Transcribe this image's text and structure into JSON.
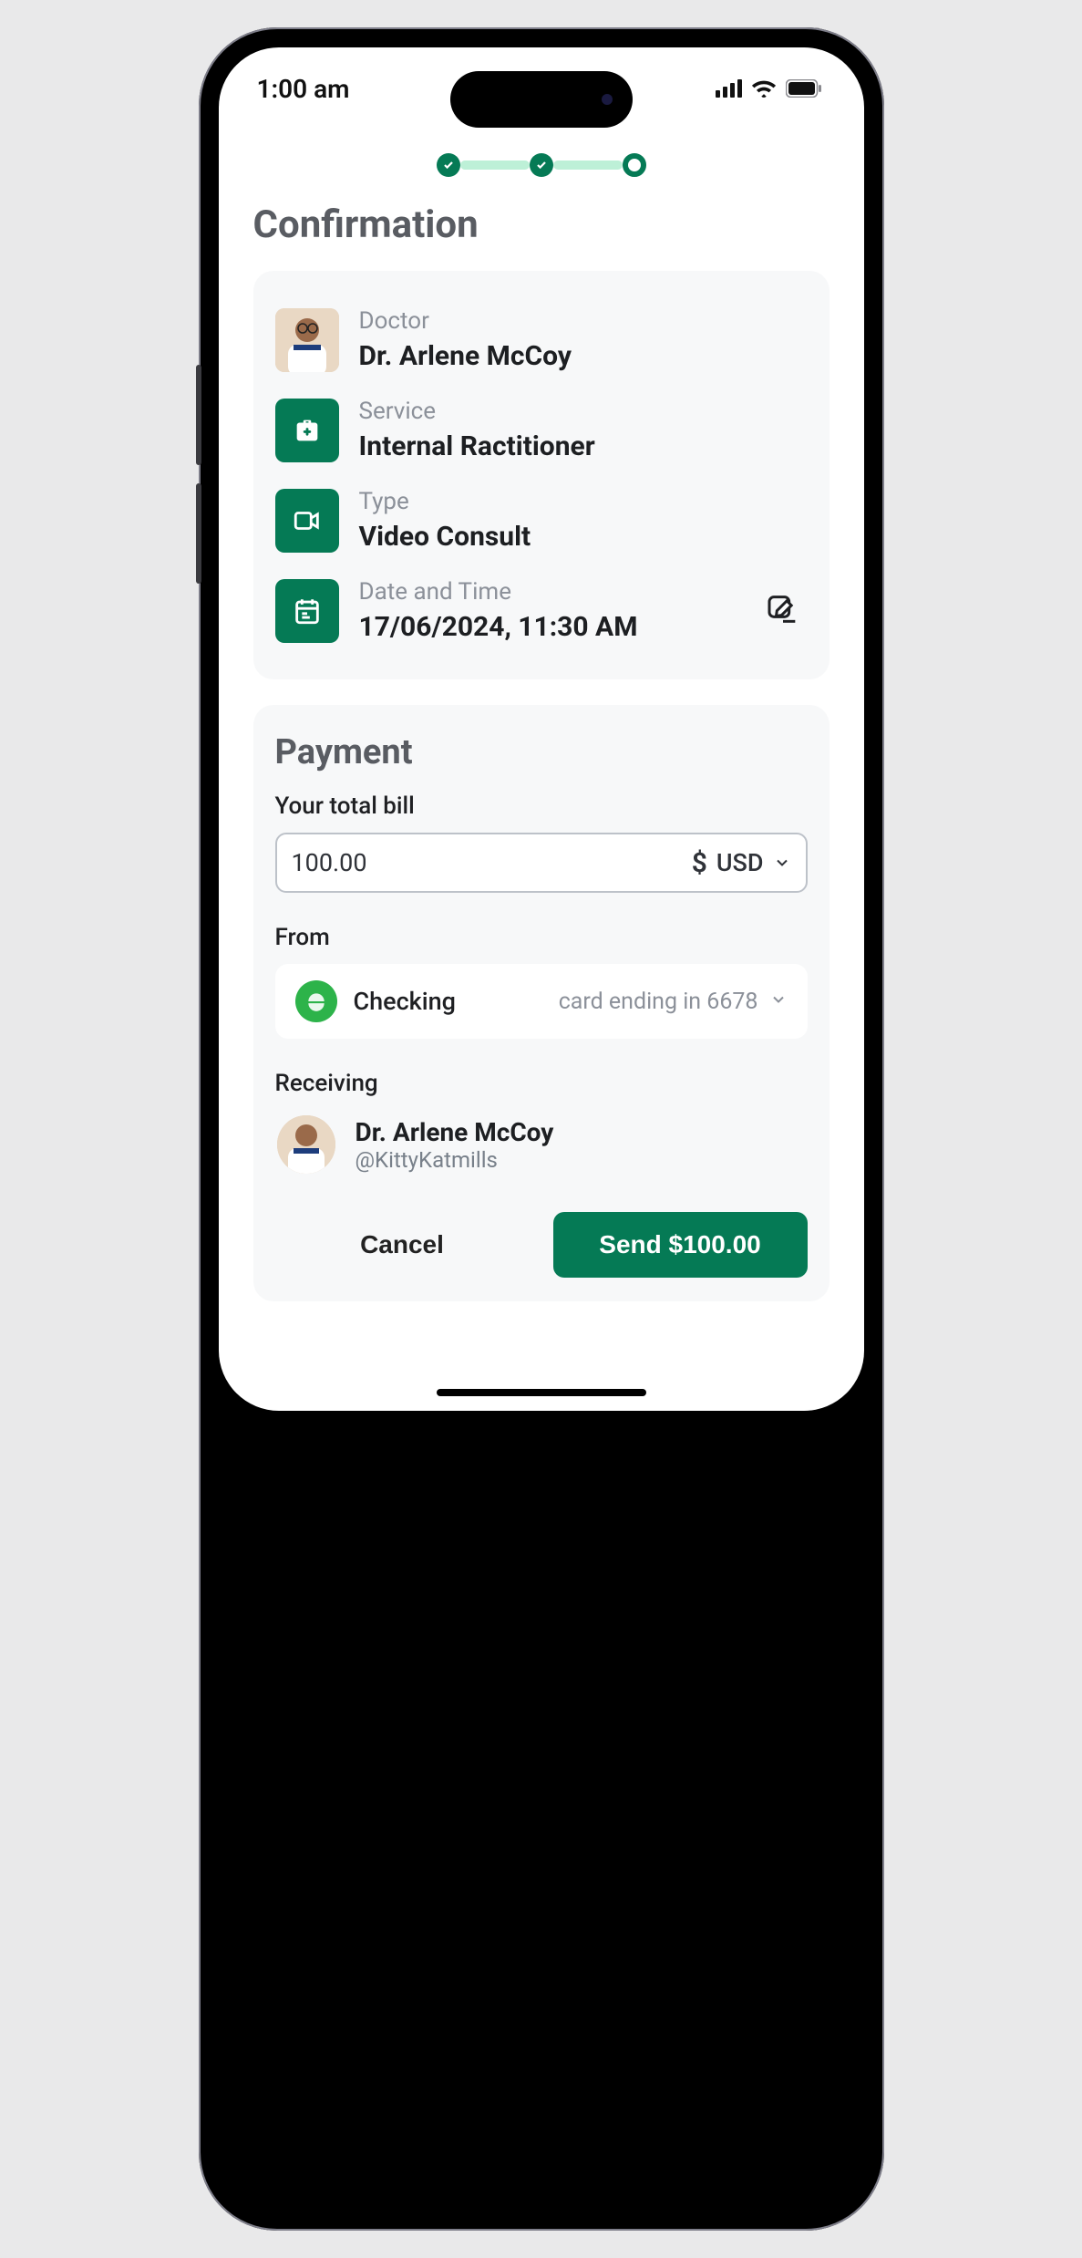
{
  "status_bar": {
    "time": "1:00 am"
  },
  "title": "Confirmation",
  "summary": {
    "doctor": {
      "label": "Doctor",
      "value": "Dr. Arlene McCoy"
    },
    "service": {
      "label": "Service",
      "value": "Internal Ractitioner"
    },
    "type": {
      "label": "Type",
      "value": "Video Consult"
    },
    "datetime": {
      "label": "Date and Time",
      "value": "17/06/2024, 11:30 AM"
    }
  },
  "payment": {
    "title": "Payment",
    "bill_label": "Your total bill",
    "amount": "100.00",
    "currency_symbol": "$",
    "currency_code": "USD",
    "from_label": "From",
    "from_account": "Checking",
    "from_detail": "card ending in 6678",
    "receiving_label": "Receiving",
    "receiving_name": "Dr. Arlene McCoy",
    "receiving_handle": "@KittyKatmills"
  },
  "actions": {
    "cancel": "Cancel",
    "send": "Send $100.00"
  }
}
